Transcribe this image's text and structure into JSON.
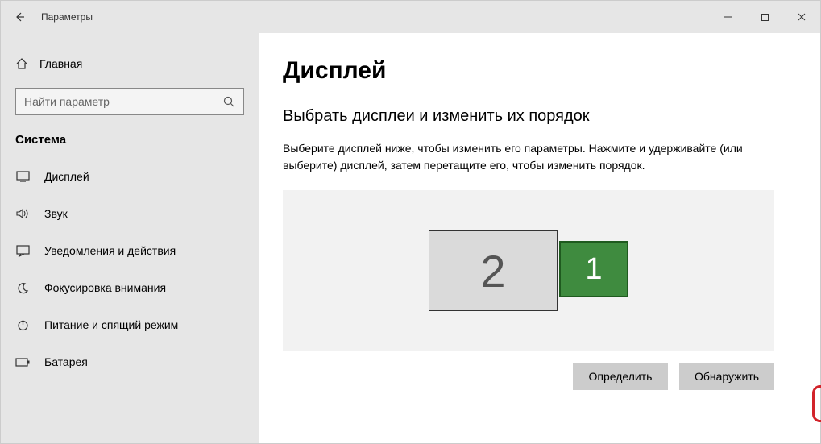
{
  "window": {
    "title": "Параметры"
  },
  "sidebar": {
    "home": "Главная",
    "search_placeholder": "Найти параметр",
    "section": "Система",
    "items": [
      {
        "label": "Дисплей"
      },
      {
        "label": "Звук"
      },
      {
        "label": "Уведомления и действия"
      },
      {
        "label": "Фокусировка внимания"
      },
      {
        "label": "Питание и спящий режим"
      },
      {
        "label": "Батарея"
      }
    ]
  },
  "page": {
    "title": "Дисплей",
    "subtitle": "Выбрать дисплеи и изменить их порядок",
    "description": "Выберите дисплей ниже, чтобы изменить его параметры. Нажмите и удерживайте (или выберите) дисплей, затем перетащите его, чтобы изменить порядок.",
    "monitors": [
      {
        "id": "2",
        "selected": false
      },
      {
        "id": "1",
        "selected": true
      }
    ],
    "buttons": {
      "identify": "Определить",
      "detect": "Обнаружить"
    }
  }
}
